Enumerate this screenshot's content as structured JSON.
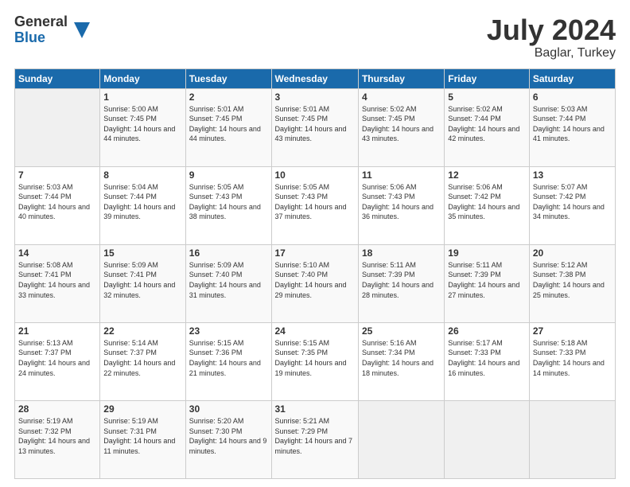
{
  "logo": {
    "general": "General",
    "blue": "Blue"
  },
  "header": {
    "month_year": "July 2024",
    "location": "Baglar, Turkey"
  },
  "columns": [
    "Sunday",
    "Monday",
    "Tuesday",
    "Wednesday",
    "Thursday",
    "Friday",
    "Saturday"
  ],
  "weeks": [
    [
      {
        "day": "",
        "sunrise": "",
        "sunset": "",
        "daylight": ""
      },
      {
        "day": "1",
        "sunrise": "Sunrise: 5:00 AM",
        "sunset": "Sunset: 7:45 PM",
        "daylight": "Daylight: 14 hours and 44 minutes."
      },
      {
        "day": "2",
        "sunrise": "Sunrise: 5:01 AM",
        "sunset": "Sunset: 7:45 PM",
        "daylight": "Daylight: 14 hours and 44 minutes."
      },
      {
        "day": "3",
        "sunrise": "Sunrise: 5:01 AM",
        "sunset": "Sunset: 7:45 PM",
        "daylight": "Daylight: 14 hours and 43 minutes."
      },
      {
        "day": "4",
        "sunrise": "Sunrise: 5:02 AM",
        "sunset": "Sunset: 7:45 PM",
        "daylight": "Daylight: 14 hours and 43 minutes."
      },
      {
        "day": "5",
        "sunrise": "Sunrise: 5:02 AM",
        "sunset": "Sunset: 7:44 PM",
        "daylight": "Daylight: 14 hours and 42 minutes."
      },
      {
        "day": "6",
        "sunrise": "Sunrise: 5:03 AM",
        "sunset": "Sunset: 7:44 PM",
        "daylight": "Daylight: 14 hours and 41 minutes."
      }
    ],
    [
      {
        "day": "7",
        "sunrise": "Sunrise: 5:03 AM",
        "sunset": "Sunset: 7:44 PM",
        "daylight": "Daylight: 14 hours and 40 minutes."
      },
      {
        "day": "8",
        "sunrise": "Sunrise: 5:04 AM",
        "sunset": "Sunset: 7:44 PM",
        "daylight": "Daylight: 14 hours and 39 minutes."
      },
      {
        "day": "9",
        "sunrise": "Sunrise: 5:05 AM",
        "sunset": "Sunset: 7:43 PM",
        "daylight": "Daylight: 14 hours and 38 minutes."
      },
      {
        "day": "10",
        "sunrise": "Sunrise: 5:05 AM",
        "sunset": "Sunset: 7:43 PM",
        "daylight": "Daylight: 14 hours and 37 minutes."
      },
      {
        "day": "11",
        "sunrise": "Sunrise: 5:06 AM",
        "sunset": "Sunset: 7:43 PM",
        "daylight": "Daylight: 14 hours and 36 minutes."
      },
      {
        "day": "12",
        "sunrise": "Sunrise: 5:06 AM",
        "sunset": "Sunset: 7:42 PM",
        "daylight": "Daylight: 14 hours and 35 minutes."
      },
      {
        "day": "13",
        "sunrise": "Sunrise: 5:07 AM",
        "sunset": "Sunset: 7:42 PM",
        "daylight": "Daylight: 14 hours and 34 minutes."
      }
    ],
    [
      {
        "day": "14",
        "sunrise": "Sunrise: 5:08 AM",
        "sunset": "Sunset: 7:41 PM",
        "daylight": "Daylight: 14 hours and 33 minutes."
      },
      {
        "day": "15",
        "sunrise": "Sunrise: 5:09 AM",
        "sunset": "Sunset: 7:41 PM",
        "daylight": "Daylight: 14 hours and 32 minutes."
      },
      {
        "day": "16",
        "sunrise": "Sunrise: 5:09 AM",
        "sunset": "Sunset: 7:40 PM",
        "daylight": "Daylight: 14 hours and 31 minutes."
      },
      {
        "day": "17",
        "sunrise": "Sunrise: 5:10 AM",
        "sunset": "Sunset: 7:40 PM",
        "daylight": "Daylight: 14 hours and 29 minutes."
      },
      {
        "day": "18",
        "sunrise": "Sunrise: 5:11 AM",
        "sunset": "Sunset: 7:39 PM",
        "daylight": "Daylight: 14 hours and 28 minutes."
      },
      {
        "day": "19",
        "sunrise": "Sunrise: 5:11 AM",
        "sunset": "Sunset: 7:39 PM",
        "daylight": "Daylight: 14 hours and 27 minutes."
      },
      {
        "day": "20",
        "sunrise": "Sunrise: 5:12 AM",
        "sunset": "Sunset: 7:38 PM",
        "daylight": "Daylight: 14 hours and 25 minutes."
      }
    ],
    [
      {
        "day": "21",
        "sunrise": "Sunrise: 5:13 AM",
        "sunset": "Sunset: 7:37 PM",
        "daylight": "Daylight: 14 hours and 24 minutes."
      },
      {
        "day": "22",
        "sunrise": "Sunrise: 5:14 AM",
        "sunset": "Sunset: 7:37 PM",
        "daylight": "Daylight: 14 hours and 22 minutes."
      },
      {
        "day": "23",
        "sunrise": "Sunrise: 5:15 AM",
        "sunset": "Sunset: 7:36 PM",
        "daylight": "Daylight: 14 hours and 21 minutes."
      },
      {
        "day": "24",
        "sunrise": "Sunrise: 5:15 AM",
        "sunset": "Sunset: 7:35 PM",
        "daylight": "Daylight: 14 hours and 19 minutes."
      },
      {
        "day": "25",
        "sunrise": "Sunrise: 5:16 AM",
        "sunset": "Sunset: 7:34 PM",
        "daylight": "Daylight: 14 hours and 18 minutes."
      },
      {
        "day": "26",
        "sunrise": "Sunrise: 5:17 AM",
        "sunset": "Sunset: 7:33 PM",
        "daylight": "Daylight: 14 hours and 16 minutes."
      },
      {
        "day": "27",
        "sunrise": "Sunrise: 5:18 AM",
        "sunset": "Sunset: 7:33 PM",
        "daylight": "Daylight: 14 hours and 14 minutes."
      }
    ],
    [
      {
        "day": "28",
        "sunrise": "Sunrise: 5:19 AM",
        "sunset": "Sunset: 7:32 PM",
        "daylight": "Daylight: 14 hours and 13 minutes."
      },
      {
        "day": "29",
        "sunrise": "Sunrise: 5:19 AM",
        "sunset": "Sunset: 7:31 PM",
        "daylight": "Daylight: 14 hours and 11 minutes."
      },
      {
        "day": "30",
        "sunrise": "Sunrise: 5:20 AM",
        "sunset": "Sunset: 7:30 PM",
        "daylight": "Daylight: 14 hours and 9 minutes."
      },
      {
        "day": "31",
        "sunrise": "Sunrise: 5:21 AM",
        "sunset": "Sunset: 7:29 PM",
        "daylight": "Daylight: 14 hours and 7 minutes."
      },
      {
        "day": "",
        "sunrise": "",
        "sunset": "",
        "daylight": ""
      },
      {
        "day": "",
        "sunrise": "",
        "sunset": "",
        "daylight": ""
      },
      {
        "day": "",
        "sunrise": "",
        "sunset": "",
        "daylight": ""
      }
    ]
  ]
}
